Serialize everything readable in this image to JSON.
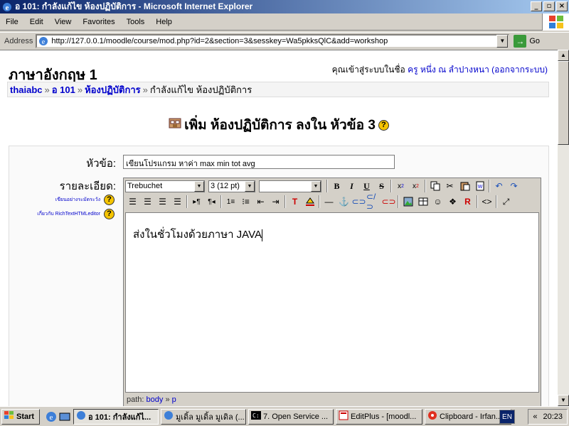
{
  "window": {
    "title": "อ 101: กำลังแก้ไข ห้องปฏิบัติการ - Microsoft Internet Explorer",
    "min": "_",
    "max": "▫",
    "close": "×"
  },
  "menu": [
    "File",
    "Edit",
    "View",
    "Favorites",
    "Tools",
    "Help"
  ],
  "address": {
    "label": "Address",
    "url": "http://127.0.0.1/moodle/course/mod.php?id=2&section=3&sesskey=Wa5pkksQlC&add=workshop",
    "go": "Go"
  },
  "page": {
    "course_title": "ภาษาอังกฤษ 1",
    "login_prefix": "คุณเข้าสู่ระบบในชื่อ ",
    "login_user": "ครู หนึ่ง ณ ลำปางหนา",
    "logout": "(ออกจากระบบ)",
    "breadcrumb": {
      "site": "thaiabc",
      "course": "อ 101",
      "activity": "ห้องปฏิบัติการ",
      "current": "กำลังแก้ไข ห้องปฏิบัติการ",
      "separator": "»"
    },
    "heading": "เพิ่ม ห้องปฏิบัติการ ลงใน หัวข้อ 3",
    "help_symbol": "?"
  },
  "form": {
    "subject_label": "หัวข้อ:",
    "subject_value": "เขียนโปรแกรม หาค่า max min tot avg",
    "description_label": "รายละเอียด:",
    "help_link_1": "เขียนอย่างระมัดระวัง",
    "help_link_2": "เกี่ยวกับ RichTextHTMLeditor"
  },
  "editor": {
    "font": "Trebuchet",
    "size": "3 (12 pt)",
    "style": "",
    "content": "ส่งในชั่วโมงด้วยภาษา JAVA",
    "path_label": "path:",
    "path_body": "body",
    "path_sep": "»",
    "path_p": "p"
  },
  "taskbar": {
    "start": "Start",
    "tasks": [
      "อ 101: กำลังแก้ไ...",
      "มูเดิ้ล มูเดิ้ล มูเดิล (...",
      "7. Open Service ...",
      "EditPlus - [moodl...",
      "Clipboard - Irfan..."
    ],
    "lang": "EN",
    "clock": "20:23",
    "chevron": "«"
  },
  "colors": {
    "title_gradient_start": "#0a246a",
    "link": "#0000cc",
    "help_yellow": "#f5c400"
  }
}
